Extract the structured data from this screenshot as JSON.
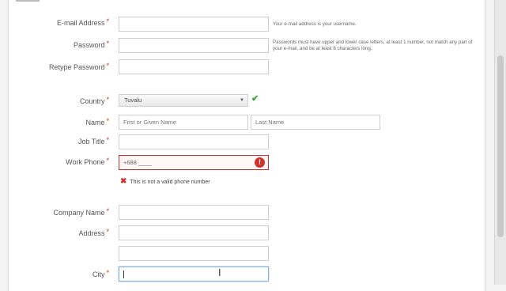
{
  "form": {
    "email": {
      "label": "E-mail Address",
      "value": "",
      "hint": "Your e-mail address is your username."
    },
    "password": {
      "label": "Password",
      "value": "",
      "hint": "Passwords must have upper and lower case letters, at least 1 number, not match any part of your e-mail, and be at least 8 characters long."
    },
    "retype_password": {
      "label": "Retype Password",
      "value": ""
    },
    "country": {
      "label": "Country",
      "selected": "Tuvalu",
      "status_icon": "check-icon"
    },
    "name": {
      "label": "Name",
      "first_placeholder": "First or Given Name",
      "last_placeholder": "Last Name"
    },
    "job_title": {
      "label": "Job Title",
      "value": ""
    },
    "work_phone": {
      "label": "Work Phone",
      "value": "+688 ____",
      "error_icon_text": "!",
      "error_message": "This is not a valid phone number"
    },
    "company_name": {
      "label": "Company Name",
      "value": ""
    },
    "address": {
      "label": "Address",
      "line1": "",
      "line2": ""
    },
    "city": {
      "label": "City",
      "value": ""
    },
    "required_marker": "*"
  },
  "colors": {
    "required": "#d0312d",
    "error": "#d0312d",
    "valid": "#3aa53a",
    "focus": "#7fb0d9"
  }
}
